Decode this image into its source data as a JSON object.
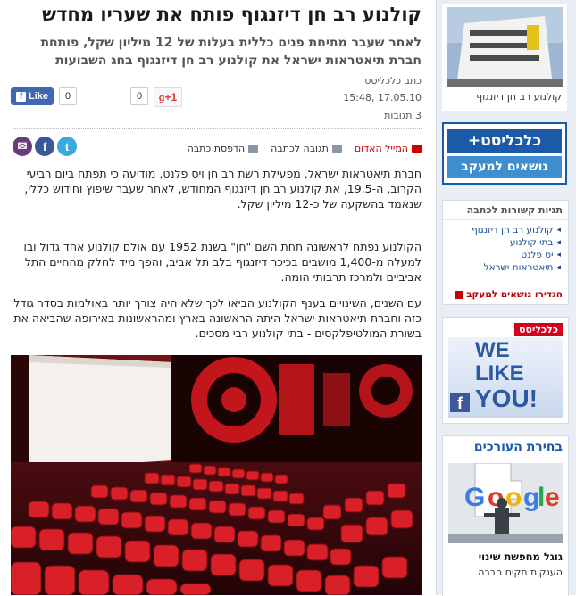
{
  "article": {
    "title": "קולנוע רב חן דיזנגוף פותח את שעריו מחדש",
    "subtitle": "לאחר שעבר מתיחת פנים כללית בעלות של 12 מיליון שקל, פותחת חברת תיאטראות ישראל את קולנוע רב חן דיזנגוף בחג השבועות",
    "author": "כתב כלכליסט",
    "datetime": "17.05.10 ,15:48",
    "comments_count": "3 תגובות",
    "paragraphs": [
      "חברת תיאטראות ישראל, מפעילת רשת רב חן ויס פלנט, מודיעה כי תפתח ביום רביעי הקרוב, ה-19.5, את קולנוע רב חן דיזנגוף המחודש, לאחר שעבר שיפוץ וחידוש כללי, שנאמד בהשקעה של כ-12 מיליון שקל.",
      "הקולנוע נפתח לראשונה תחת השם \"חן\" בשנת 1952 עם אולם קולנוע אחד גדול ובו למעלה מ-1,400 מושבים בכיכר דיזנגוף בלב תל אביב, והפך מיד לחלק מהחיים התל אביביים ולמרכז תרבותי הומה.",
      "עם השנים, השינויים בענף הקולנוע הביאו לכך שלא היה צורך יותר באולמות בסדר גודל כזה וחברת תיאטראות ישראל היתה הראשונה בארץ ומהראשונות באירופה שהביאה את בשורת המולטיפלקסים - בתי קולנוע רבי מסכים."
    ]
  },
  "social": {
    "fb_like_label": "Like",
    "fb_count": "0",
    "gplus_count": "0",
    "gplus_label": "+1",
    "twitter_glyph": "t",
    "facebook_glyph": "f",
    "mail_glyph": "✉"
  },
  "toolbar": {
    "mail_red": "המייל האדום",
    "comment": "תגובה לכתבה",
    "print": "הדפסת כתבה"
  },
  "sidebar": {
    "photo_caption": "קולנוע רב חן דיזנגוף",
    "brand_top": "כלכליסט+",
    "brand_bottom": "נושאים למעקב",
    "tags_title": "תגיות קשורות לכתבה",
    "tags": [
      "קולנוע רב חן דיזנגוף",
      "בתי קולנוע",
      "יס פלנט",
      "תיאטראות ישראל"
    ],
    "tags_cta": "הגדירו נושאים למעקב",
    "promo_brand": "כלכליסט",
    "promo_we": "WE",
    "promo_like": "LIKE",
    "promo_you": "YOU!",
    "editors_title": "בחירת העורכים",
    "editors_item_title": "גוגל מחפשת שינוי",
    "editors_item_sub": "הענקית תקים חברה"
  },
  "colors": {
    "brand_blue": "#1b5aa6",
    "facebook_blue": "#3b5998",
    "twitter_blue": "#3aa9e0",
    "accent_red": "#c00000",
    "seat_red": "#d91f28"
  }
}
